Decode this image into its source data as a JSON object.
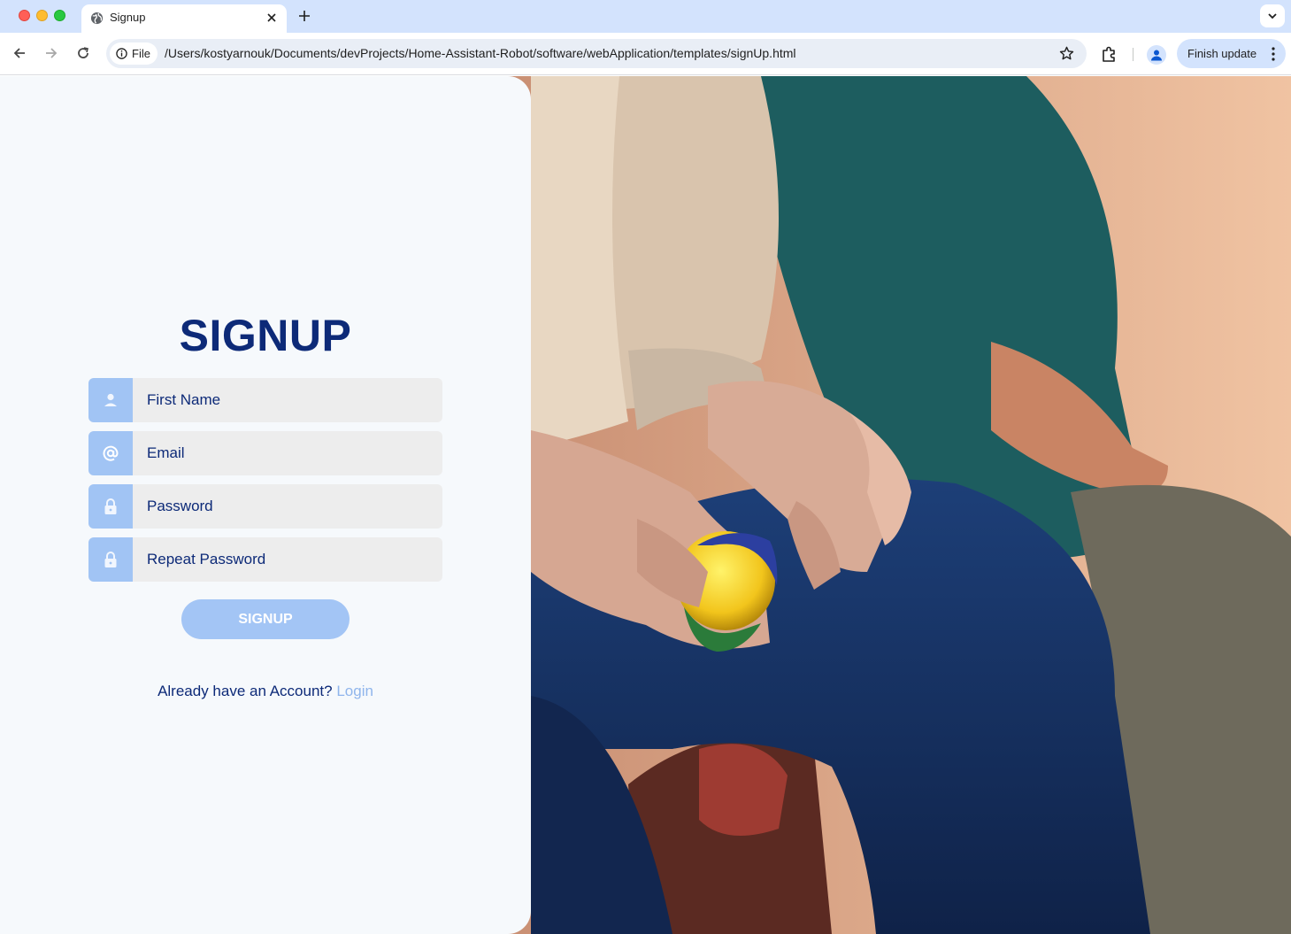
{
  "browser": {
    "tab_title": "Signup",
    "security_chip": "File",
    "url": "/Users/kostyarnouk/Documents/devProjects/Home-Assistant-Robot/software/webApplication/templates/signUp.html",
    "update_button": "Finish update"
  },
  "page": {
    "title": "SIGNUP",
    "fields": [
      {
        "placeholder": "First Name",
        "icon": "user-icon"
      },
      {
        "placeholder": "Email",
        "icon": "at-icon"
      },
      {
        "placeholder": "Password",
        "icon": "lock-icon"
      },
      {
        "placeholder": "Repeat Password",
        "icon": "lock-icon"
      }
    ],
    "submit_label": "SIGNUP",
    "login_prompt": "Already have an Account?",
    "login_link": "Login"
  },
  "colors": {
    "accent": "#a1c4f4",
    "heading": "#0d2a78",
    "link": "#8fb5ec",
    "panel_bg": "#f6f9fc"
  },
  "image": {
    "description_icon": "photo-elderly-hands-holding-ball"
  }
}
